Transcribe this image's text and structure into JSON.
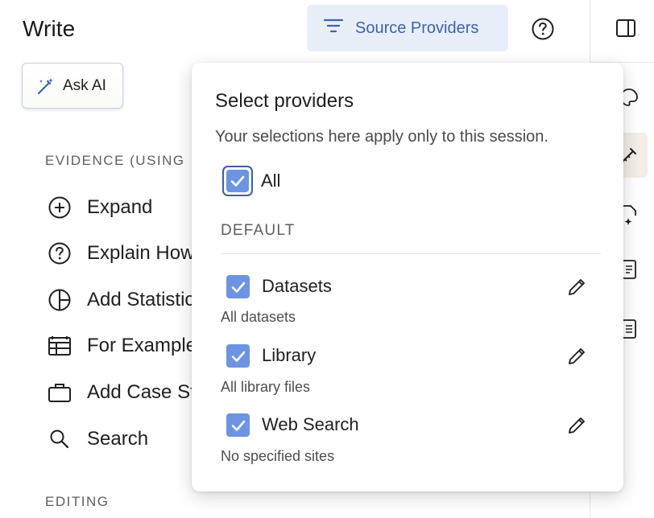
{
  "header": {
    "title": "Write",
    "source_providers_label": "Source Providers"
  },
  "ask_ai": {
    "label": "Ask AI"
  },
  "sections": {
    "evidence": "EVIDENCE (USING",
    "editing": "EDITING"
  },
  "menu": [
    {
      "label": "Expand",
      "icon": "plus-circle-icon"
    },
    {
      "label": "Explain How",
      "icon": "question-circle-icon"
    },
    {
      "label": "Add Statistics",
      "icon": "pie-chart-icon"
    },
    {
      "label": "For Example",
      "icon": "table-icon"
    },
    {
      "label": "Add Case Study",
      "icon": "briefcase-icon"
    },
    {
      "label": "Search",
      "icon": "search-icon"
    }
  ],
  "popover": {
    "title": "Select providers",
    "subtitle": "Your selections here apply only to this session.",
    "all_label": "All",
    "all_checked": true,
    "default_section": "DEFAULT",
    "providers": [
      {
        "label": "Datasets",
        "description": "All datasets",
        "checked": true
      },
      {
        "label": "Library",
        "description": "All library files",
        "checked": true
      },
      {
        "label": "Web Search",
        "description": "No specified sites",
        "checked": true
      }
    ]
  },
  "colors": {
    "accent": "#3b63b0",
    "source_btn_bg": "#e8eef7",
    "checkbox": "#6c94e2",
    "rail_active_bg": "#f3ece7"
  }
}
